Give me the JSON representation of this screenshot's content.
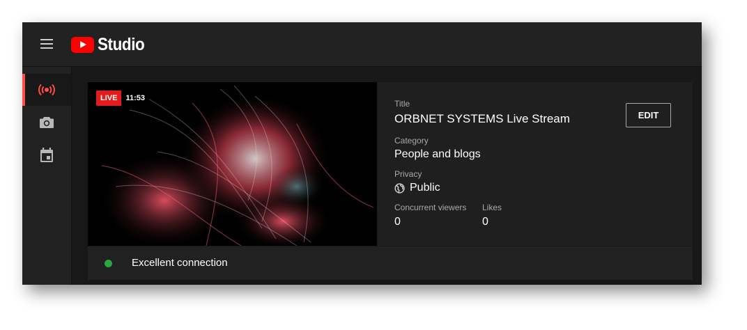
{
  "app": {
    "logo_text": "Studio",
    "brand_color": "#ff0000"
  },
  "sidebar": {
    "items": [
      {
        "icon": "live-broadcast-icon",
        "active": true
      },
      {
        "icon": "camera-icon",
        "active": false
      },
      {
        "icon": "calendar-icon",
        "active": false
      }
    ],
    "accent_color": "#ff4e45"
  },
  "stream": {
    "live_label": "LIVE",
    "elapsed": "11:53",
    "title_label": "Title",
    "title": "ORBNET SYSTEMS Live Stream",
    "category_label": "Category",
    "category": "People and blogs",
    "privacy_label": "Privacy",
    "privacy_icon": "globe-icon",
    "privacy": "Public",
    "viewers_label": "Concurrent viewers",
    "viewers": "0",
    "likes_label": "Likes",
    "likes": "0",
    "edit_label": "EDIT"
  },
  "status": {
    "text": "Excellent connection",
    "color": "#2ba640"
  }
}
